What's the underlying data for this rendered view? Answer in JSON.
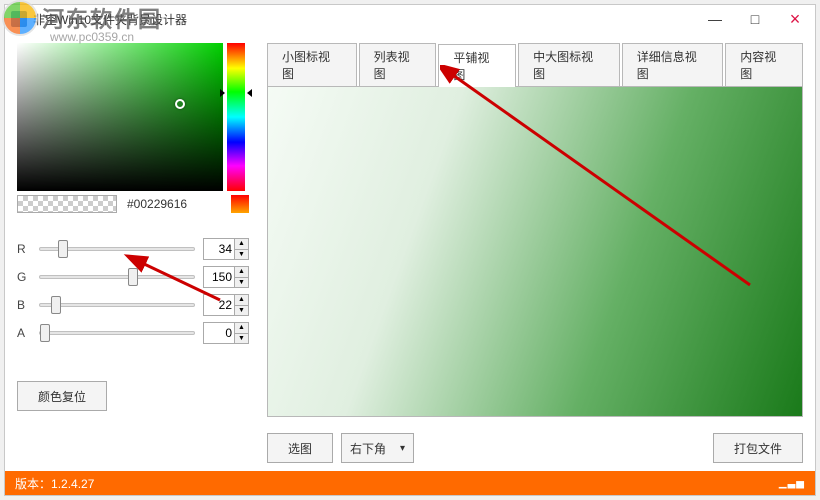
{
  "window": {
    "title": "非空Win10文件夹背景设计器",
    "minimize": "—",
    "maximize": "□",
    "close": "×"
  },
  "color": {
    "hex": "#00229616",
    "r": 34,
    "g": 150,
    "b": 22,
    "a": 0,
    "r_label": "R",
    "g_label": "G",
    "b_label": "B",
    "a_label": "A"
  },
  "buttons": {
    "reset": "颜色复位",
    "choose_image": "选图",
    "position": "右下角",
    "pack": "打包文件"
  },
  "tabs": [
    {
      "label": "小图标视图",
      "active": false
    },
    {
      "label": "列表视图",
      "active": false
    },
    {
      "label": "平铺视图",
      "active": true
    },
    {
      "label": "中大图标视图",
      "active": false
    },
    {
      "label": "详细信息视图",
      "active": false
    },
    {
      "label": "内容视图",
      "active": false
    }
  ],
  "status": {
    "version_label": "版本：",
    "version": "1.2.4.27"
  },
  "watermark": {
    "text": "河东软件园",
    "url": "www.pc0359.cn"
  }
}
